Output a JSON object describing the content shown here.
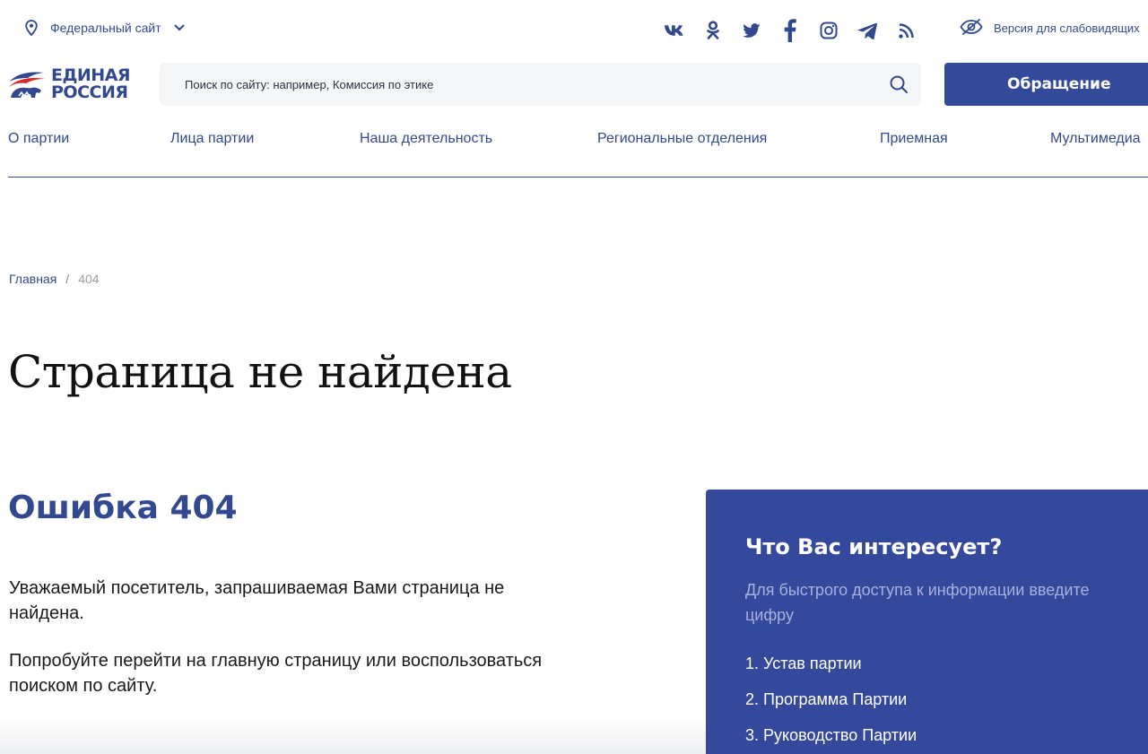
{
  "topbar": {
    "region_label": "Федеральный сайт",
    "region_icon": "map-pin-icon",
    "social": [
      "vk-icon",
      "odnoklassniki-icon",
      "twitter-icon",
      "facebook-icon",
      "instagram-icon",
      "telegram-icon",
      "rss-icon"
    ],
    "vision_label": "Версия для слабовидящих"
  },
  "header": {
    "logo_line1": "ЕДИНАЯ",
    "logo_line2": "РОССИЯ",
    "search_placeholder": "Поиск по сайту: например, Комиссия по этике",
    "appeal_label": "Обращение"
  },
  "nav": {
    "items": [
      "О партии",
      "Лица партии",
      "Наша деятельность",
      "Региональные отделения",
      "Приемная",
      "Мультимедиа"
    ]
  },
  "breadcrumb": {
    "home": "Главная",
    "separator": "/",
    "current": "404"
  },
  "main": {
    "title": "Страница не найдена",
    "error_heading": "Ошибка 404",
    "paragraph1": "Уважаемый посетитель, запрашиваемая Вами страница не найдена.",
    "paragraph2": "Попробуйте перейти на главную страницу или воспользоваться поиском по сайту."
  },
  "panel": {
    "heading": "Что Вас интересует?",
    "subtitle": "Для быстрого доступа к информации введите цифру",
    "links": [
      "1. Устав партии",
      "2. Программа Партии",
      "3. Руководство Партии"
    ]
  },
  "colors": {
    "brand_blue": "#33498f",
    "panel_blue": "#34499c",
    "search_bg": "#f5f6f8"
  }
}
